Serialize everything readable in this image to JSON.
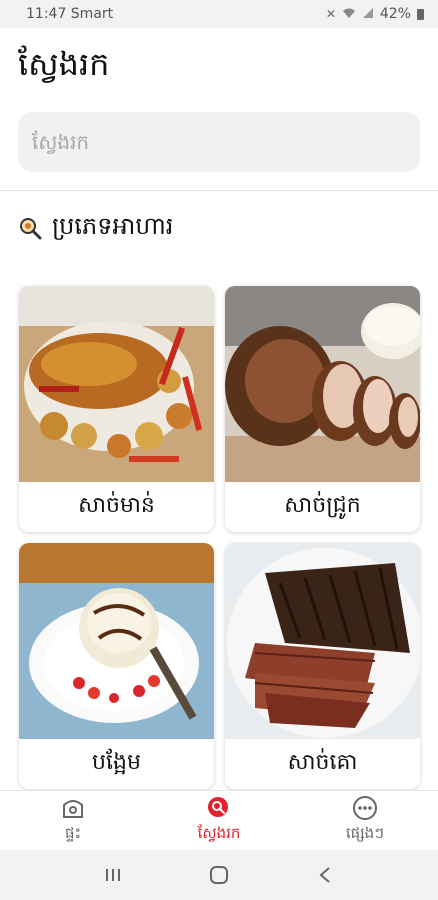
{
  "status_bar": {
    "time": "11:47 Smart",
    "battery": "42%",
    "icons": [
      "mute-icon",
      "wifi-icon",
      "signal-icon",
      "battery-icon"
    ]
  },
  "header": {
    "title": "ស្វែងរក"
  },
  "search": {
    "placeholder": "ស្វែងរក"
  },
  "section": {
    "title": "ប្រភេទអាហារ",
    "icon": "search-food-icon"
  },
  "categories": [
    {
      "label": "សាច់មាន់",
      "image": "roast-chicken-photo"
    },
    {
      "label": "សាច់ជ្រូក",
      "image": "roast-pork-photo"
    },
    {
      "label": "បង្អែម",
      "image": "dessert-photo"
    },
    {
      "label": "សាច់គោ",
      "image": "beef-steak-photo"
    }
  ],
  "bottom_nav": [
    {
      "label": "ផ្ទះ",
      "icon": "home-icon",
      "active": false
    },
    {
      "label": "ស្វែងរក",
      "icon": "search-icon",
      "active": true
    },
    {
      "label": "ផ្សេងៗ",
      "icon": "more-icon",
      "active": false
    }
  ],
  "colors": {
    "accent": "#e4202d",
    "background": "#ffffff",
    "search_bg": "#f1f1f1"
  }
}
